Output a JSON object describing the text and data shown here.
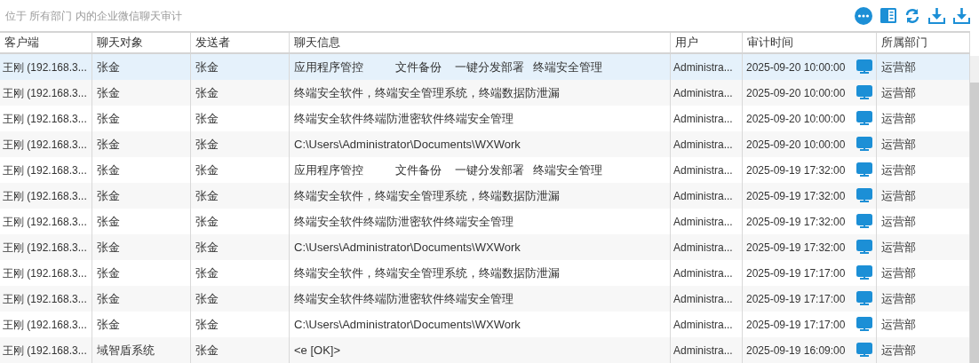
{
  "title": "位于 所有部门 内的企业微信聊天审计",
  "columns": [
    "客户端",
    "聊天对象",
    "发送者",
    "聊天信息",
    "用户",
    "审计时间",
    "所属部门"
  ],
  "rows": [
    {
      "selected": true,
      "client": "王刚 (192.168.3...",
      "target": "张金",
      "sender": "张金",
      "message": "应用程序管控          文件备份    一键分发部署   终端安全管理",
      "user": "Administra...",
      "time": "2025-09-20 10:00:00",
      "dept": "运营部"
    },
    {
      "selected": false,
      "client": "王刚 (192.168.3...",
      "target": "张金",
      "sender": "张金",
      "message": "终端安全软件，终端安全管理系统，终端数据防泄漏",
      "user": "Administra...",
      "time": "2025-09-20 10:00:00",
      "dept": "运营部"
    },
    {
      "selected": false,
      "client": "王刚 (192.168.3...",
      "target": "张金",
      "sender": "张金",
      "message": "终端安全软件终端防泄密软件终端安全管理",
      "user": "Administra...",
      "time": "2025-09-20 10:00:00",
      "dept": "运营部"
    },
    {
      "selected": false,
      "client": "王刚 (192.168.3...",
      "target": "张金",
      "sender": "张金",
      "message": "C:\\Users\\Administrator\\Documents\\WXWork",
      "user": "Administra...",
      "time": "2025-09-20 10:00:00",
      "dept": "运营部"
    },
    {
      "selected": false,
      "client": "王刚 (192.168.3...",
      "target": "张金",
      "sender": "张金",
      "message": "应用程序管控          文件备份    一键分发部署   终端安全管理",
      "user": "Administra...",
      "time": "2025-09-19 17:32:00",
      "dept": "运营部"
    },
    {
      "selected": false,
      "client": "王刚 (192.168.3...",
      "target": "张金",
      "sender": "张金",
      "message": "终端安全软件，终端安全管理系统，终端数据防泄漏",
      "user": "Administra...",
      "time": "2025-09-19 17:32:00",
      "dept": "运营部"
    },
    {
      "selected": false,
      "client": "王刚 (192.168.3...",
      "target": "张金",
      "sender": "张金",
      "message": "终端安全软件终端防泄密软件终端安全管理",
      "user": "Administra...",
      "time": "2025-09-19 17:32:00",
      "dept": "运营部"
    },
    {
      "selected": false,
      "client": "王刚 (192.168.3...",
      "target": "张金",
      "sender": "张金",
      "message": "C:\\Users\\Administrator\\Documents\\WXWork",
      "user": "Administra...",
      "time": "2025-09-19 17:32:00",
      "dept": "运营部"
    },
    {
      "selected": false,
      "client": "王刚 (192.168.3...",
      "target": "张金",
      "sender": "张金",
      "message": "终端安全软件，终端安全管理系统，终端数据防泄漏",
      "user": "Administra...",
      "time": "2025-09-19 17:17:00",
      "dept": "运营部"
    },
    {
      "selected": false,
      "client": "王刚 (192.168.3...",
      "target": "张金",
      "sender": "张金",
      "message": "终端安全软件终端防泄密软件终端安全管理",
      "user": "Administra...",
      "time": "2025-09-19 17:17:00",
      "dept": "运营部"
    },
    {
      "selected": false,
      "client": "王刚 (192.168.3...",
      "target": "张金",
      "sender": "张金",
      "message": "C:\\Users\\Administrator\\Documents\\WXWork",
      "user": "Administra...",
      "time": "2025-09-19 17:17:00",
      "dept": "运营部"
    },
    {
      "selected": false,
      "client": "王刚 (192.168.3...",
      "target": "域智盾系统",
      "sender": "张金",
      "message": "<e [OK]>",
      "user": "Administra...",
      "time": "2025-09-19 16:09:00",
      "dept": "运营部"
    }
  ]
}
